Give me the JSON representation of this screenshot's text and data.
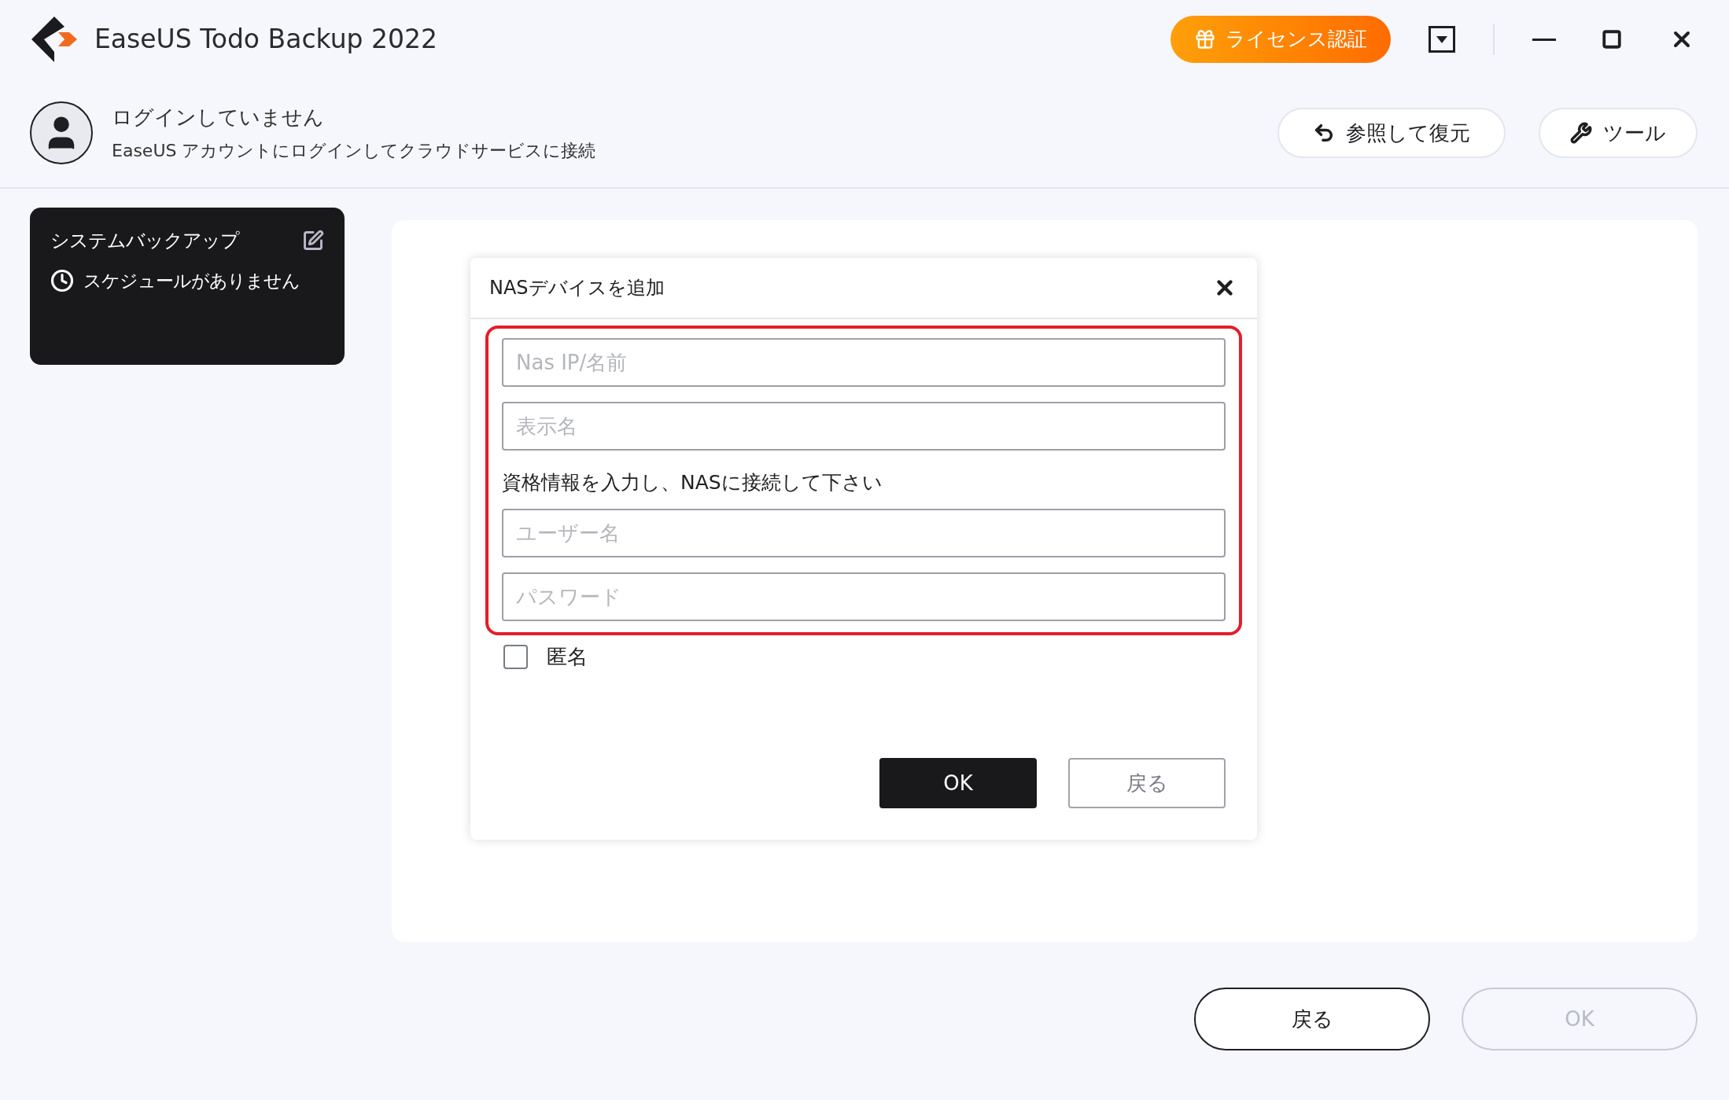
{
  "window": {
    "title": "EaseUS Todo Backup 2022",
    "license_button": "ライセンス認証"
  },
  "account": {
    "status": "ログインしていません",
    "hint": "EaseUS アカウントにログインしてクラウドサービスに接続"
  },
  "toolbar": [
    {
      "kind": "restore",
      "label": "参照して復元"
    },
    {
      "kind": "tools",
      "label": "ツール"
    }
  ],
  "backup_card": {
    "title": "システムバックアップ",
    "schedule": "スケジュールがありません"
  },
  "dialog": {
    "title": "NASデバイスを追加",
    "fields": [
      {
        "placeholder": "Nas IP/名前"
      },
      {
        "placeholder": "表示名"
      }
    ],
    "credentials_label": "資格情報を入力し、NASに接続して下さい",
    "credential_fields": [
      {
        "placeholder": "ユーザー名"
      },
      {
        "placeholder": "パスワード"
      }
    ],
    "anonymous": {
      "label": "匿名",
      "checked": false
    },
    "buttons": [
      {
        "label": "OK",
        "kind": "primary"
      },
      {
        "label": "戻る",
        "kind": "secondary"
      }
    ]
  },
  "footer_buttons": [
    {
      "label": "戻る",
      "disabled": false
    },
    {
      "label": "OK",
      "disabled": true
    }
  ]
}
